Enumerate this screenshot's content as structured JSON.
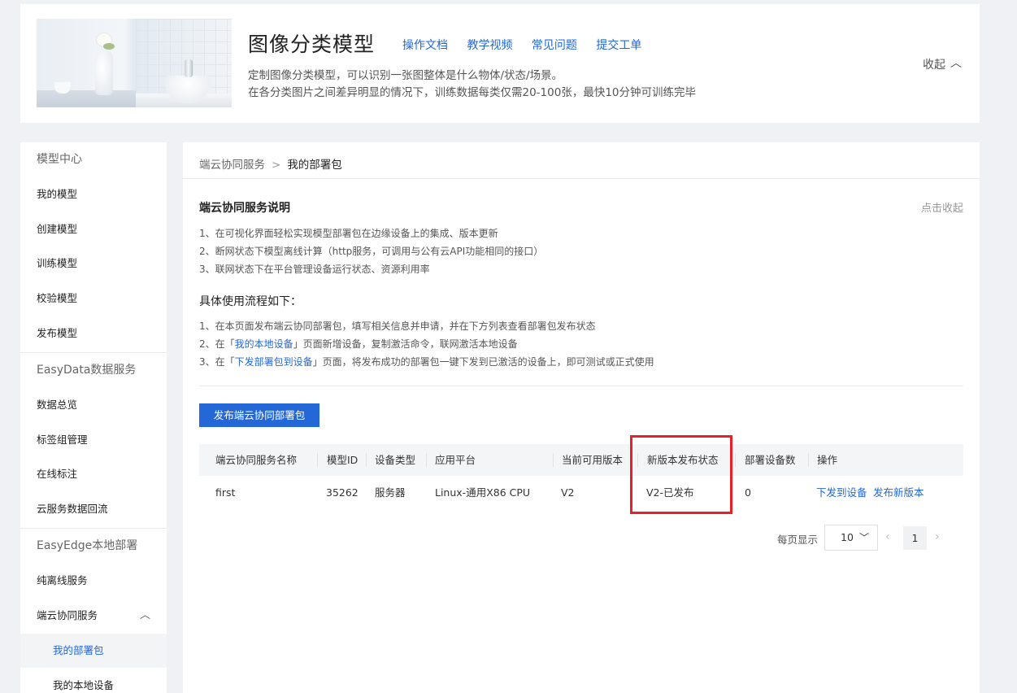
{
  "header": {
    "title": "图像分类模型",
    "links": [
      "操作文档",
      "教学视频",
      "常见问题",
      "提交工单"
    ],
    "desc_line1": "定制图像分类模型，可以识别一张图整体是什么物体/状态/场景。",
    "desc_line2": "在各分类图片之间差异明显的情况下，训练数据每类仅需20-100张，最快10分钟可训练完毕",
    "collapse_label": "收起"
  },
  "sidebar": {
    "group_model": "模型中心",
    "model_items": [
      "我的模型",
      "创建模型",
      "训练模型",
      "校验模型",
      "发布模型"
    ],
    "group_data": "EasyData数据服务",
    "data_items": [
      "数据总览",
      "标签组管理",
      "在线标注",
      "云服务数据回流"
    ],
    "group_edge": "EasyEdge本地部署",
    "edge_items": [
      "纯离线服务",
      "端云协同服务"
    ],
    "sub_items": [
      "我的部署包",
      "我的本地设备"
    ]
  },
  "breadcrumb": {
    "parent": "端云协同服务",
    "current": "我的部署包"
  },
  "intro": {
    "title": "端云协同服务说明",
    "fold_label": "点击收起",
    "points": [
      "1、在可视化界面轻松实现模型部署包在边缘设备上的集成、版本更新",
      "2、断网状态下模型离线计算（http服务，可调用与公有云API功能相同的接口）",
      "3、联网状态下在平台管理设备运行状态、资源利用率"
    ],
    "flow_title": "具体使用流程如下：",
    "step1": "1、在本页面发布端云协同部署包，填写相关信息并申请，并在下方列表查看部署包发布状态",
    "step2_prefix": "2、在「",
    "step2_link": "我的本地设备",
    "step2_suffix": "」页面新增设备，复制激活命令，联网激活本地设备",
    "step3_prefix": "3、在「",
    "step3_link": "下发部署包到设备",
    "step3_suffix": "」页面，将发布成功的部署包一键下发到已激活的设备上，即可测试或正式使用"
  },
  "publish_button": "发布端云协同部署包",
  "table": {
    "headers": [
      "端云协同服务名称",
      "模型ID",
      "设备类型",
      "应用平台",
      "当前可用版本",
      "新版本发布状态",
      "部署设备数",
      "操作"
    ],
    "rows": [
      {
        "name": "first",
        "model_id": "35262",
        "device_type": "服务器",
        "platform": "Linux-通用X86 CPU",
        "version": "V2",
        "status": "V2-已发布",
        "devices": "0",
        "action1": "下发到设备",
        "action2": "发布新版本"
      }
    ]
  },
  "pagination": {
    "per_page_label": "每页显示",
    "page_size": "10",
    "current_page": "1"
  }
}
